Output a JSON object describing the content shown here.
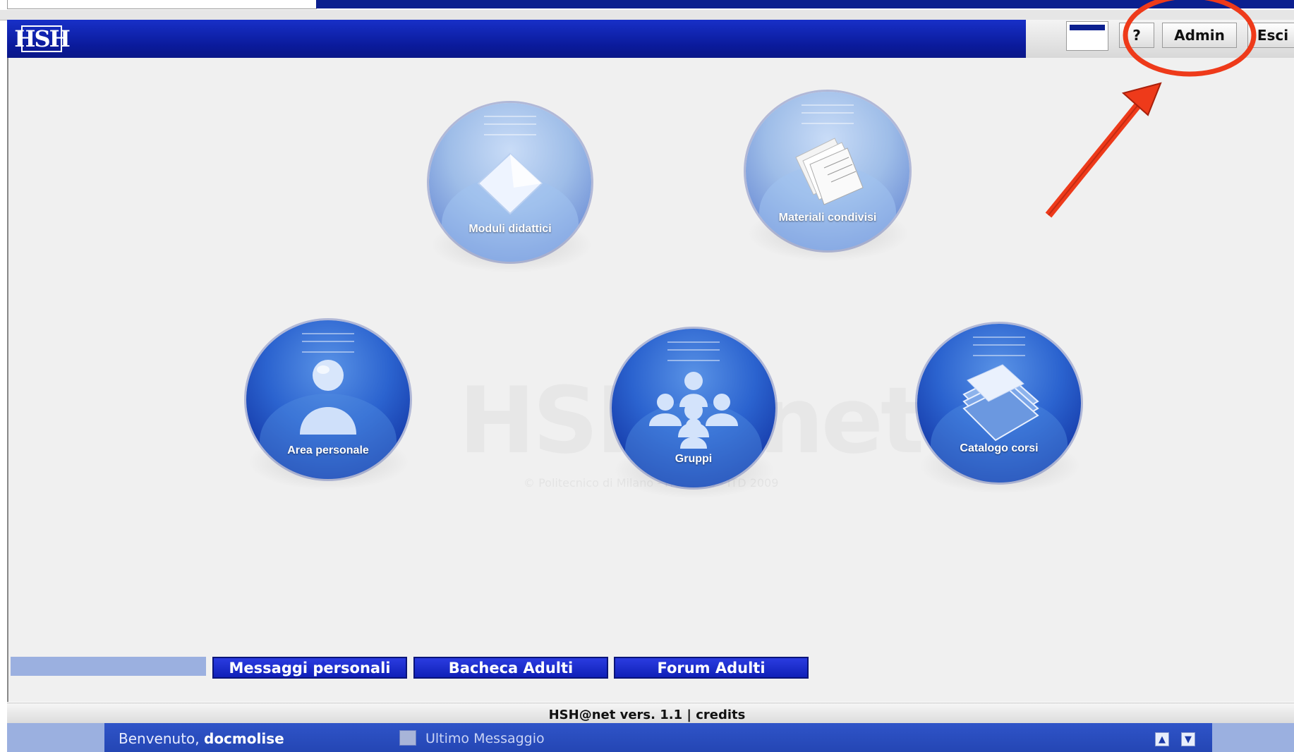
{
  "header": {
    "logo_text": "HSH",
    "help_label": "?",
    "admin_label": "Admin",
    "exit_label": "Esci"
  },
  "tiles": [
    {
      "label": "Moduli didattici",
      "icon": "folder-icon"
    },
    {
      "label": "Materiali condivisi",
      "icon": "documents-icon"
    },
    {
      "label": "Area personale",
      "icon": "user-icon"
    },
    {
      "label": "Gruppi",
      "icon": "group-icon"
    },
    {
      "label": "Catalogo corsi",
      "icon": "books-icon"
    }
  ],
  "watermark": {
    "text": "HSH@net",
    "sub": "© Politecnico di Milano - HOC-LAB - ITD 2009"
  },
  "nav_buttons": {
    "messaggi": "Messaggi personali",
    "bacheca": "Bacheca Adulti",
    "forum": "Forum Adulti"
  },
  "footer": {
    "version": "HSH@net vers. 1.1",
    "separator": " | ",
    "credits": "credits"
  },
  "status": {
    "welcome_prefix": "Benvenuto,",
    "username": "docmolise",
    "last_message": "Ultimo Messaggio"
  },
  "colors": {
    "header_blue": "#0a1a9a",
    "annotation_red": "#ee3a1a",
    "nav_button_blue": "#1020b8"
  }
}
